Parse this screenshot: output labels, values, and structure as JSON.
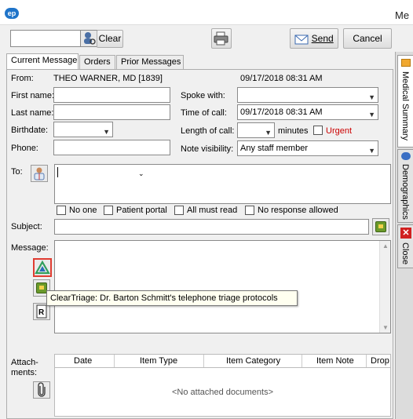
{
  "window": {
    "title": "Me",
    "app_icon": "ep"
  },
  "toolbar": {
    "search_value": "",
    "clear_label": "Clear",
    "send_label": "Send",
    "cancel_label": "Cancel"
  },
  "tabs": [
    {
      "label": "Current Message",
      "active": true
    },
    {
      "label": "Orders",
      "active": false
    },
    {
      "label": "Prior Messages",
      "active": false
    }
  ],
  "from": {
    "label": "From:",
    "value": "THEO WARNER, MD [1839]",
    "timestamp": "09/17/2018 08:31 AM"
  },
  "form": {
    "first_name_label": "First name:",
    "first_name": "",
    "last_name_label": "Last name:",
    "last_name": "",
    "birthdate_label": "Birthdate:",
    "birthdate": "",
    "phone_label": "Phone:",
    "phone": "",
    "spoke_with_label": "Spoke with:",
    "spoke_with": "",
    "time_of_call_label": "Time of call:",
    "time_of_call": "09/17/2018 08:31 AM",
    "length_of_call_label": "Length of call:",
    "length_of_call": "",
    "minutes_label": "minutes",
    "urgent_label": "Urgent",
    "urgent_color": "#cc0000",
    "note_visibility_label": "Note visibility:",
    "note_visibility": "Any staff member"
  },
  "to": {
    "label": "To:",
    "value": ""
  },
  "flags": [
    {
      "label": "No one",
      "checked": false
    },
    {
      "label": "Patient portal",
      "checked": false
    },
    {
      "label": "All must read",
      "checked": false
    },
    {
      "label": "No response allowed",
      "checked": false
    }
  ],
  "subject": {
    "label": "Subject:",
    "value": ""
  },
  "message": {
    "label": "Message:",
    "value": ""
  },
  "tooltip": "ClearTriage: Dr. Barton Schmitt's telephone triage protocols",
  "attachments": {
    "label_line1": "Attach-",
    "label_line2": "ments:",
    "columns": [
      "Date",
      "Item Type",
      "Item Category",
      "Item Note",
      "Drop"
    ],
    "empty_text": "<No attached documents>"
  },
  "side_tabs": [
    {
      "label": "Medical Summary",
      "icon": "folder-icon",
      "active": true
    },
    {
      "label": "Demographics",
      "icon": "people-icon",
      "active": false
    },
    {
      "label": "Close",
      "icon": "close-icon",
      "active": false
    }
  ]
}
